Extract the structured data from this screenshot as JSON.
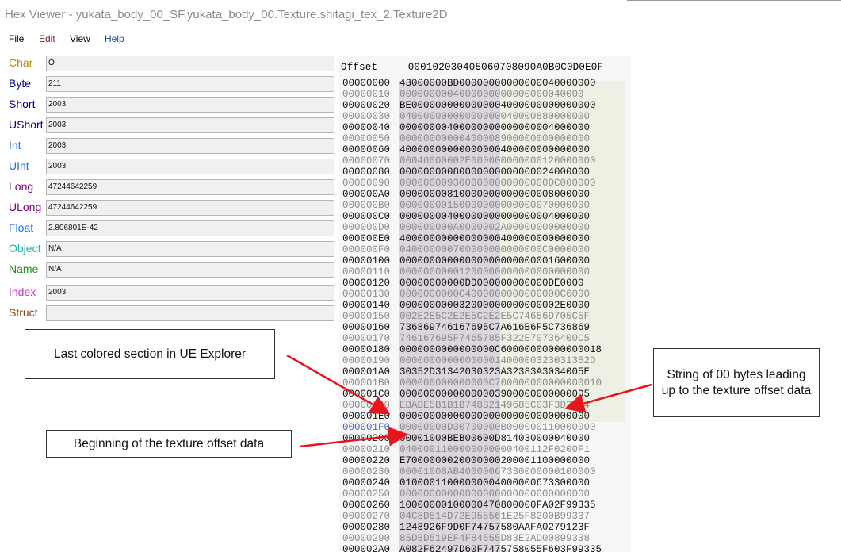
{
  "window": {
    "title": "Hex Viewer - yukata_body_00_SF.yukata_body_00.Texture.shitagi_tex_2.Texture2D"
  },
  "menu": [
    {
      "label": "File",
      "color": "#000000"
    },
    {
      "label": "Edit",
      "color": "#8b1a1a"
    },
    {
      "label": "View",
      "color": "#000000"
    },
    {
      "label": "Help",
      "color": "#1a4fa8"
    }
  ],
  "properties": [
    {
      "label": "Char",
      "value": "Ó",
      "color": "#b8860b"
    },
    {
      "label": "Byte",
      "value": "211",
      "color": "#00008b"
    },
    {
      "label": "Short",
      "value": "2003",
      "color": "#00008b"
    },
    {
      "label": "UShort",
      "value": "2003",
      "color": "#00008b"
    },
    {
      "label": "Int",
      "value": "2003",
      "color": "#1e6fd9"
    },
    {
      "label": "UInt",
      "value": "2003",
      "color": "#1e6fd9"
    },
    {
      "label": "Long",
      "value": "47244642259",
      "color": "#800080"
    },
    {
      "label": "ULong",
      "value": "47244642259",
      "color": "#800080"
    },
    {
      "label": "Float",
      "value": "2.806801E-42",
      "color": "#1e6fd9"
    },
    {
      "label": "Object",
      "value": "N/A",
      "color": "#20b2aa"
    },
    {
      "label": "Name",
      "value": "N/A",
      "color": "#228b22"
    },
    {
      "label": "Index",
      "value": "2003",
      "color": "#c040c0"
    },
    {
      "label": "Struct",
      "value": "",
      "color": "#8b4513"
    }
  ],
  "hex": {
    "header_label": "Offset",
    "header_columns": "000102030405060708090A0B0C0D0E0F",
    "rows": [
      {
        "offset": "00000000",
        "data": "43000000BD00000000000000040000000"
      },
      {
        "offset": "00000010",
        "data": "0000000004000000000000000040000"
      },
      {
        "offset": "00000020",
        "data": "BE0000000000000004000000000000000"
      },
      {
        "offset": "00000030",
        "data": "04000000000000000040000880000000"
      },
      {
        "offset": "00000040",
        "data": "00000000400000000000000004000000"
      },
      {
        "offset": "00000050",
        "data": "00000000000400008900000000000000"
      },
      {
        "offset": "00000060",
        "data": "40000000000000000400000000000000"
      },
      {
        "offset": "00000070",
        "data": "00040000002E000000000000120000000"
      },
      {
        "offset": "00000080",
        "data": "00000000080000000000000024000000"
      },
      {
        "offset": "00000090",
        "data": "0000000093000000000000000DC000000"
      },
      {
        "offset": "000000A0",
        "data": "00000000810000000000000008000000"
      },
      {
        "offset": "000000B0",
        "data": "00000000150000000000000070000000"
      },
      {
        "offset": "000000C0",
        "data": "00000000400000000000000004000000"
      },
      {
        "offset": "000000D0",
        "data": "000000000A0000002A00000000000000"
      },
      {
        "offset": "000000E0",
        "data": "40000000000000000400000000000000"
      },
      {
        "offset": "000000F0",
        "data": "040000000700000000000000C0000000"
      },
      {
        "offset": "00000100",
        "data": "00000000000000000000000001600000"
      },
      {
        "offset": "00000110",
        "data": "00000000001200000000000000000000"
      },
      {
        "offset": "00000120",
        "data": "00000000000DD000000000000DE0000"
      },
      {
        "offset": "00000130",
        "data": "0000000000C4000000000000000C6000"
      },
      {
        "offset": "00000140",
        "data": "000000000032000000000000002E0000"
      },
      {
        "offset": "00000150",
        "data": "002E2E5C2E2E5C2E2E5C74656D705C5F"
      },
      {
        "offset": "00000160",
        "data": "736869746167695C7A616B6F5C736869"
      },
      {
        "offset": "00000170",
        "data": "746167695F7465785F322E70736400C5"
      },
      {
        "offset": "00000180",
        "data": "0000000000000000C60000000000000018"
      },
      {
        "offset": "00000190",
        "data": "00000000000000001400000323031352D"
      },
      {
        "offset": "000001A0",
        "data": "30352D31342030323A32383A3034005E"
      },
      {
        "offset": "000001B0",
        "data": "000000000000000C700000000000000010"
      },
      {
        "offset": "000001C0",
        "data": "000000000000000039000000000000D5"
      },
      {
        "offset": "000001D0",
        "data": "EBABE5B1B1B748B2149685C03F3D3184"
      },
      {
        "offset": "000001E0",
        "data": "00000000000000000000000000000000"
      },
      {
        "offset": "000001F0",
        "data": "00000000D30700000B000000110000000"
      },
      {
        "offset": "00000200",
        "data": "00001000BEB00600D814030000040000"
      },
      {
        "offset": "00000210",
        "data": "0400001100000000000400112F0200F1"
      },
      {
        "offset": "00000220",
        "data": "E7000000020000000200001100000000"
      },
      {
        "offset": "00000230",
        "data": "00001008AB40000067330000000100000"
      },
      {
        "offset": "00000240",
        "data": "01000011000000004000000673300000"
      },
      {
        "offset": "00000250",
        "data": "00000000000000000000000000000000"
      },
      {
        "offset": "00000260",
        "data": "10000000100000470800000FA02F99335"
      },
      {
        "offset": "00000270",
        "data": "04C8D514D72E955561E25F8200B99337"
      },
      {
        "offset": "00000280",
        "data": "1248926F9D0F74757580AAFA0279123F"
      },
      {
        "offset": "00000290",
        "data": "85D8D519EF4F84555D83E2AD00899338"
      },
      {
        "offset": "000002A0",
        "data": "A082F62497D60F7475758055F603F99335"
      }
    ]
  },
  "annotations": {
    "last_colored": "Last colored section in UE Explorer",
    "string_zero": "String of 00 bytes leading up to the texture offset data",
    "begin_offset": "Beginning of the texture offset data"
  }
}
